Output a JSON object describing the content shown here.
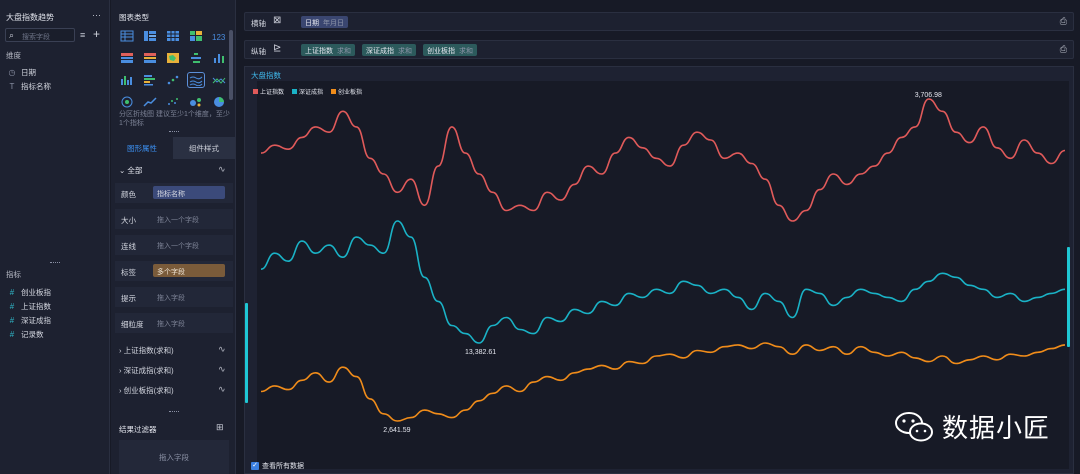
{
  "data_panel": {
    "title": "大盘指数趋势",
    "more": "···",
    "search_placeholder": "搜索字段",
    "dimension_label": "维度",
    "dimensions": [
      {
        "icon": "clock-icon",
        "glyph": "◷",
        "label": "日期"
      },
      {
        "icon": "text-icon",
        "glyph": "T",
        "label": "指标名称"
      }
    ],
    "measure_label": "指标",
    "measures": [
      {
        "glyph": "#",
        "label": "创业板指"
      },
      {
        "glyph": "#",
        "label": "上证指数"
      },
      {
        "glyph": "#",
        "label": "深证成指"
      },
      {
        "glyph": "#",
        "label": "记录数"
      }
    ]
  },
  "type_panel": {
    "title": "图表类型",
    "hint": "分区折线图 建议至少1个维度，至少1个指标",
    "tabs": [
      "图形属性",
      "组件样式"
    ],
    "all_label": "全部",
    "props": [
      {
        "label": "颜色",
        "slot": "指标名称",
        "style": "blue"
      },
      {
        "label": "大小",
        "slot": "拖入一个字段",
        "style": ""
      },
      {
        "label": "连线",
        "slot": "拖入一个字段",
        "style": ""
      },
      {
        "label": "标签",
        "slot": "多个字段",
        "style": "brown"
      },
      {
        "label": "提示",
        "slot": "拖入字段",
        "style": ""
      },
      {
        "label": "细粒度",
        "slot": "拖入字段",
        "style": ""
      }
    ],
    "series_rows": [
      "上证指数(求和)",
      "深证成指(求和)",
      "创业板指(求和)"
    ],
    "filter_title": "结果过滤器",
    "filter_drop": "拖入字段"
  },
  "x_axis": {
    "label": "横轴",
    "pills": [
      {
        "name": "日期",
        "sub": "年月日"
      }
    ]
  },
  "y_axis": {
    "label": "纵轴",
    "pills": [
      {
        "name": "上证指数",
        "sub": "求和"
      },
      {
        "name": "深证成指",
        "sub": "求和"
      },
      {
        "name": "创业板指",
        "sub": "求和"
      }
    ]
  },
  "chart": {
    "title": "大盘指数",
    "legend": [
      {
        "name": "上证指数",
        "color": "#e05a5a"
      },
      {
        "name": "深证成指",
        "color": "#1ab2c6"
      },
      {
        "name": "创业板指",
        "color": "#f08c1a"
      }
    ],
    "check_all": "查看所有数据"
  },
  "chart_data": {
    "type": "line",
    "layout": "stacked-panels",
    "x_label": "",
    "y_label": "",
    "grid": false,
    "series": [
      {
        "name": "上证指数",
        "color": "#e05a5a",
        "annotation": {
          "text": "3,706.98",
          "label": "3,706.98"
        },
        "values": [
          3500,
          3530,
          3515,
          3560,
          3600,
          3580,
          3660,
          3600,
          3480,
          3420,
          3350,
          3400,
          3300,
          3450,
          3600,
          3500,
          3420,
          3350,
          3280,
          3300,
          3280,
          3350,
          3320,
          3380,
          3450,
          3420,
          3500,
          3560,
          3520,
          3480,
          3450,
          3530,
          3580,
          3550,
          3480,
          3500,
          3460,
          3400,
          3300,
          3240,
          3280,
          3360,
          3420,
          3380,
          3420,
          3450,
          3500,
          3560,
          3600,
          3706.98,
          3660,
          3580,
          3540,
          3600,
          3520,
          3480,
          3550,
          3500,
          3460,
          3510
        ]
      },
      {
        "name": "深证成指",
        "color": "#1ab2c6",
        "annotation": {
          "text": "13,382.61",
          "label": "13,382.61"
        },
        "values": [
          14300,
          14500,
          14400,
          14650,
          14500,
          14600,
          14450,
          14700,
          14600,
          14500,
          14900,
          14700,
          14200,
          13900,
          13600,
          13500,
          13382.61,
          13600,
          13700,
          13550,
          13500,
          13700,
          13650,
          13800,
          13750,
          13900,
          13850,
          14000,
          13950,
          14050,
          14000,
          14150,
          14100,
          14000,
          14050,
          13950,
          13800,
          14000,
          13900,
          13700,
          14050,
          14000,
          13850,
          13950,
          14050,
          14000,
          13950,
          13900,
          14050,
          14150,
          14250,
          14200,
          14100,
          14050,
          13950,
          14000,
          13900,
          13950,
          14000,
          14050
        ]
      },
      {
        "name": "创业板指",
        "color": "#f08c1a",
        "annotation": {
          "text": "2,641.59",
          "label": "2,641.59"
        },
        "values": [
          2800,
          2830,
          2810,
          2860,
          2900,
          2850,
          2930,
          2880,
          2760,
          2680,
          2641.59,
          2660,
          2700,
          2680,
          2660,
          2700,
          2750,
          2790,
          2830,
          2800,
          2850,
          2880,
          2860,
          2900,
          2920,
          2940,
          2920,
          2960,
          2950,
          2990,
          3000,
          2980,
          3020,
          3010,
          3040,
          3050,
          3030,
          3060,
          3040,
          3000,
          3050,
          3020,
          3040,
          3000,
          3040,
          3010,
          2990,
          3010,
          2980,
          2960,
          2990,
          2950,
          2970,
          2990,
          2970,
          3000,
          2990,
          3010,
          3030,
          3050
        ]
      }
    ]
  },
  "watermark": "数据小匠"
}
